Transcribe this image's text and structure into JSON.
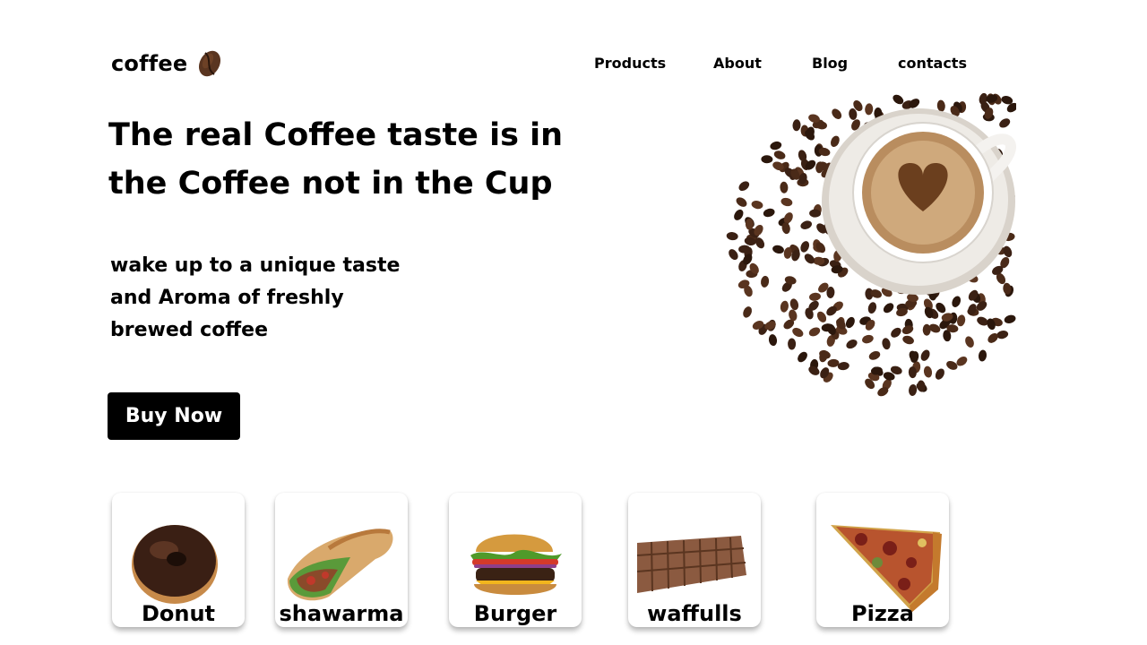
{
  "header": {
    "brand": "coffee",
    "logo_icon": "coffee-bean-icon",
    "nav": [
      "Products",
      "About",
      "Blog",
      "contacts"
    ]
  },
  "hero": {
    "headline_line1": "The real Coffee taste is in",
    "headline_line2": "the Coffee not in the Cup",
    "sub_line1": "wake up to a unique taste",
    "sub_line2": "and Aroma of freshly",
    "sub_line3": "brewed coffee",
    "cta": "Buy Now",
    "image": "coffee-cup-with-beans"
  },
  "menu": [
    {
      "label": "Donut",
      "image": "donut"
    },
    {
      "label": "shawarma",
      "image": "shawarma"
    },
    {
      "label": "Burger",
      "image": "burger"
    },
    {
      "label": "waffulls",
      "image": "waffle"
    },
    {
      "label": "Pizza",
      "image": "pizza-slice"
    }
  ],
  "colors": {
    "background": "#ffffff",
    "text": "#000000",
    "button": "#000000",
    "button_text": "#ffffff"
  }
}
